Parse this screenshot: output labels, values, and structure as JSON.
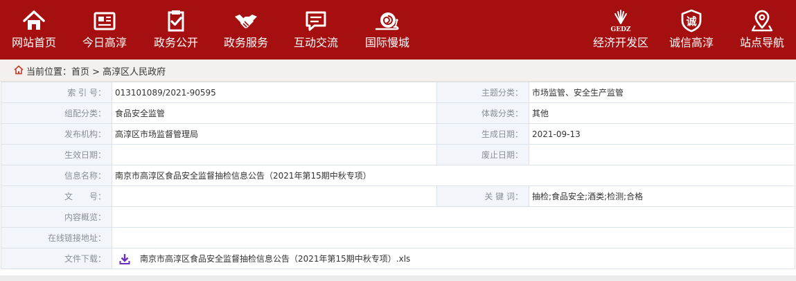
{
  "nav": {
    "items": [
      {
        "label": "网站首页",
        "icon": "home-icon"
      },
      {
        "label": "今日高淳",
        "icon": "newspaper-icon"
      },
      {
        "label": "政务公开",
        "icon": "checklist-icon"
      },
      {
        "label": "政务服务",
        "icon": "handshake-icon"
      },
      {
        "label": "互动交流",
        "icon": "chat-icon"
      },
      {
        "label": "国际慢城",
        "icon": "snail-icon"
      },
      {
        "label": "经济开发区",
        "icon": "gedz-logo-icon",
        "logo_text": "GEDZ"
      },
      {
        "label": "诚信高淳",
        "icon": "integrity-badge-icon",
        "badge_text": "诚"
      },
      {
        "label": "站点导航",
        "icon": "location-pin-icon"
      }
    ]
  },
  "breadcrumb": {
    "text": "当前位置：首页 > 高淳区人民政府"
  },
  "meta": {
    "index_label": "索 引 号：",
    "index_value": "013101089/2021-90595",
    "theme_label": "主题分类：",
    "theme_value": "市场监管、安全生产监管",
    "org_cat_label": "组配分类：",
    "org_cat_value": "食品安全监管",
    "genre_label": "体裁分类：",
    "genre_value": "其他",
    "issuer_label": "发布机构：",
    "issuer_value": "高淳区市场监督管理局",
    "date_label": "生成日期：",
    "date_value": "2021-09-13",
    "effective_label": "生效日期：",
    "effective_value": "",
    "abolish_label": "废止日期：",
    "abolish_value": "",
    "title_label": "信息名称：",
    "title_value": "南京市高淳区食品安全监督抽检信息公告（2021年第15期中秋专项）",
    "docno_label": "文　　号：",
    "docno_value": "",
    "keywords_label": "关 键 词：",
    "keywords_value": "抽检;食品安全;酒类;检测;合格",
    "summary_label": "内容概览：",
    "summary_value": "",
    "link_label": "在线链接地址：",
    "link_value": "",
    "download_label": "文件下载：",
    "download_file": "南京市高淳区食品安全监督抽检信息公告（2021年第15期中秋专项）.xls"
  },
  "colors": {
    "nav_bg": "#a50f0f",
    "label_bg": "#f2f6fa",
    "border": "#dbe2ea",
    "download_icon": "#6a2fbf"
  }
}
